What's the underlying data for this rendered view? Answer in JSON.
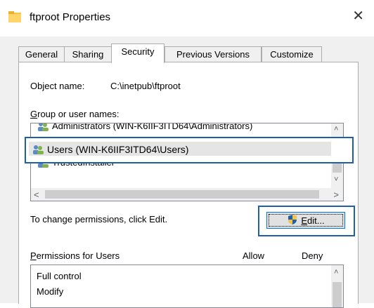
{
  "window": {
    "title": "ftproot Properties",
    "close_glyph": "✕"
  },
  "tabs": [
    {
      "label": "General"
    },
    {
      "label": "Sharing"
    },
    {
      "label": "Security",
      "active": true
    },
    {
      "label": "Previous Versions"
    },
    {
      "label": "Customize"
    }
  ],
  "security": {
    "object_name_label": "Object name:",
    "object_name_value": "C:\\inetpub\\ftproot",
    "group_label_first": "G",
    "group_label_rest": "roup or user names:",
    "users": [
      {
        "name": "Administrators (WIN-K6IIF3ITD64\\Administrators)",
        "icon": "users-group-icon"
      },
      {
        "name": "Users (WIN-K6IIF3ITD64\\Users)",
        "icon": "users-group-icon",
        "selected": true
      },
      {
        "name": "TrustedInstaller",
        "icon": "users-group-icon"
      }
    ],
    "change_text": "To change permissions, click Edit.",
    "edit_first": "E",
    "edit_rest": "dit...",
    "permissions_first": "P",
    "permissions_rest": "ermissions for Users",
    "allow_label": "Allow",
    "deny_label": "Deny",
    "permissions": [
      {
        "name": "Full control"
      },
      {
        "name": "Modify"
      }
    ]
  },
  "colors": {
    "highlight_border": "#1f5fa8",
    "focus_border": "#0078d7"
  }
}
